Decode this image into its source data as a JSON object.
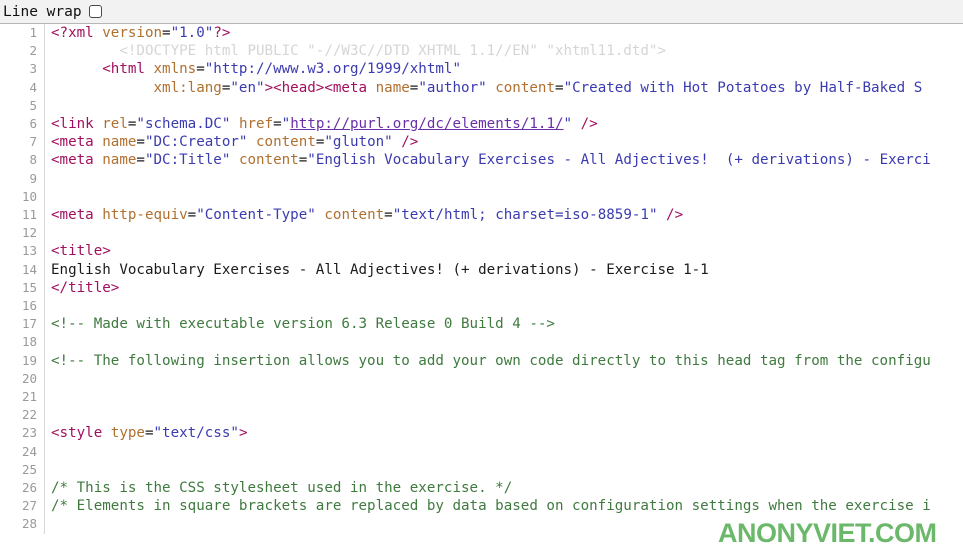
{
  "toolbar": {
    "line_wrap_label": "Line wrap",
    "line_wrap_checked": false
  },
  "watermark": {
    "text": "ANONYVIET.COM",
    "color": "#4aa84a"
  },
  "colors": {
    "tag": "#a1105e",
    "attribute": "#b07030",
    "string": "#3b3bb0",
    "comment": "#3f7a3f",
    "doctype": "#d5d5d5",
    "link": "#6a2fa8",
    "plain": "#1b1b1b",
    "gutter": "#9a9a9a",
    "toolbar_bg": "#f2f2f2",
    "background": "#ffffff"
  },
  "editor": {
    "language": "xhtml",
    "first_visible_line": 1,
    "last_visible_line": 28,
    "lines": [
      {
        "n": 1,
        "tokens": [
          {
            "t": "tag",
            "s": "<?xml "
          },
          {
            "t": "attr",
            "s": "version"
          },
          {
            "t": "punc",
            "s": "="
          },
          {
            "t": "str",
            "s": "\"1.0\""
          },
          {
            "t": "tag",
            "s": "?>"
          }
        ]
      },
      {
        "n": 2,
        "tokens": [
          {
            "t": "doctype",
            "s": "        <!DOCTYPE html PUBLIC \"-//W3C//DTD XHTML 1.1//EN\" \"xhtml11.dtd\">"
          }
        ]
      },
      {
        "n": 3,
        "tokens": [
          {
            "t": "plain",
            "s": "      "
          },
          {
            "t": "tag",
            "s": "<html "
          },
          {
            "t": "attr",
            "s": "xmlns"
          },
          {
            "t": "punc",
            "s": "="
          },
          {
            "t": "str",
            "s": "\"http://www.w3.org/1999/xhtml\""
          }
        ]
      },
      {
        "n": 4,
        "tokens": [
          {
            "t": "plain",
            "s": "            "
          },
          {
            "t": "attr",
            "s": "xml:lang"
          },
          {
            "t": "punc",
            "s": "="
          },
          {
            "t": "str",
            "s": "\"en\""
          },
          {
            "t": "tag",
            "s": "><head><meta "
          },
          {
            "t": "attr",
            "s": "name"
          },
          {
            "t": "punc",
            "s": "="
          },
          {
            "t": "str",
            "s": "\"author\""
          },
          {
            "t": "plain",
            "s": " "
          },
          {
            "t": "attr",
            "s": "content"
          },
          {
            "t": "punc",
            "s": "="
          },
          {
            "t": "str",
            "s": "\"Created with Hot Potatoes by Half-Baked S"
          }
        ]
      },
      {
        "n": 5,
        "tokens": []
      },
      {
        "n": 6,
        "tokens": [
          {
            "t": "tag",
            "s": "<link "
          },
          {
            "t": "attr",
            "s": "rel"
          },
          {
            "t": "punc",
            "s": "="
          },
          {
            "t": "str",
            "s": "\"schema.DC\""
          },
          {
            "t": "plain",
            "s": " "
          },
          {
            "t": "attr",
            "s": "href"
          },
          {
            "t": "punc",
            "s": "="
          },
          {
            "t": "str",
            "s": "\""
          },
          {
            "t": "link",
            "s": "http://purl.org/dc/elements/1.1/"
          },
          {
            "t": "str",
            "s": "\""
          },
          {
            "t": "tag",
            "s": " />"
          }
        ]
      },
      {
        "n": 7,
        "tokens": [
          {
            "t": "tag",
            "s": "<meta "
          },
          {
            "t": "attr",
            "s": "name"
          },
          {
            "t": "punc",
            "s": "="
          },
          {
            "t": "str",
            "s": "\"DC:Creator\""
          },
          {
            "t": "plain",
            "s": " "
          },
          {
            "t": "attr",
            "s": "content"
          },
          {
            "t": "punc",
            "s": "="
          },
          {
            "t": "str",
            "s": "\"gluton\""
          },
          {
            "t": "tag",
            "s": " />"
          }
        ]
      },
      {
        "n": 8,
        "tokens": [
          {
            "t": "tag",
            "s": "<meta "
          },
          {
            "t": "attr",
            "s": "name"
          },
          {
            "t": "punc",
            "s": "="
          },
          {
            "t": "str",
            "s": "\"DC:Title\""
          },
          {
            "t": "plain",
            "s": " "
          },
          {
            "t": "attr",
            "s": "content"
          },
          {
            "t": "punc",
            "s": "="
          },
          {
            "t": "str",
            "s": "\"English Vocabulary Exercises - All Adjectives!  (+ derivations) - Exerci"
          }
        ]
      },
      {
        "n": 9,
        "tokens": []
      },
      {
        "n": 10,
        "tokens": []
      },
      {
        "n": 11,
        "tokens": [
          {
            "t": "tag",
            "s": "<meta "
          },
          {
            "t": "attr",
            "s": "http-equiv"
          },
          {
            "t": "punc",
            "s": "="
          },
          {
            "t": "str",
            "s": "\"Content-Type\""
          },
          {
            "t": "plain",
            "s": " "
          },
          {
            "t": "attr",
            "s": "content"
          },
          {
            "t": "punc",
            "s": "="
          },
          {
            "t": "str",
            "s": "\"text/html; charset=iso-8859-1\""
          },
          {
            "t": "tag",
            "s": " />"
          }
        ]
      },
      {
        "n": 12,
        "tokens": []
      },
      {
        "n": 13,
        "tokens": [
          {
            "t": "tag",
            "s": "<title>"
          }
        ]
      },
      {
        "n": 14,
        "tokens": [
          {
            "t": "plain",
            "s": "English Vocabulary Exercises - All Adjectives! (+ derivations) - Exercise 1-1"
          }
        ]
      },
      {
        "n": 15,
        "tokens": [
          {
            "t": "tag",
            "s": "</title>"
          }
        ]
      },
      {
        "n": 16,
        "tokens": []
      },
      {
        "n": 17,
        "tokens": [
          {
            "t": "comment",
            "s": "<!-- Made with executable version 6.3 Release 0 Build 4 -->"
          }
        ]
      },
      {
        "n": 18,
        "tokens": []
      },
      {
        "n": 19,
        "tokens": [
          {
            "t": "comment",
            "s": "<!-- The following insertion allows you to add your own code directly to this head tag from the configu"
          }
        ]
      },
      {
        "n": 20,
        "tokens": []
      },
      {
        "n": 21,
        "tokens": []
      },
      {
        "n": 22,
        "tokens": []
      },
      {
        "n": 23,
        "tokens": [
          {
            "t": "tag",
            "s": "<style "
          },
          {
            "t": "attr",
            "s": "type"
          },
          {
            "t": "punc",
            "s": "="
          },
          {
            "t": "str",
            "s": "\"text/css\""
          },
          {
            "t": "tag",
            "s": ">"
          }
        ]
      },
      {
        "n": 24,
        "tokens": []
      },
      {
        "n": 25,
        "tokens": []
      },
      {
        "n": 26,
        "tokens": [
          {
            "t": "comment",
            "s": "/* This is the CSS stylesheet used in the exercise. */"
          }
        ]
      },
      {
        "n": 27,
        "tokens": [
          {
            "t": "comment",
            "s": "/* Elements in square brackets are replaced by data based on configuration settings when the exercise i"
          }
        ]
      },
      {
        "n": 28,
        "tokens": []
      }
    ]
  }
}
